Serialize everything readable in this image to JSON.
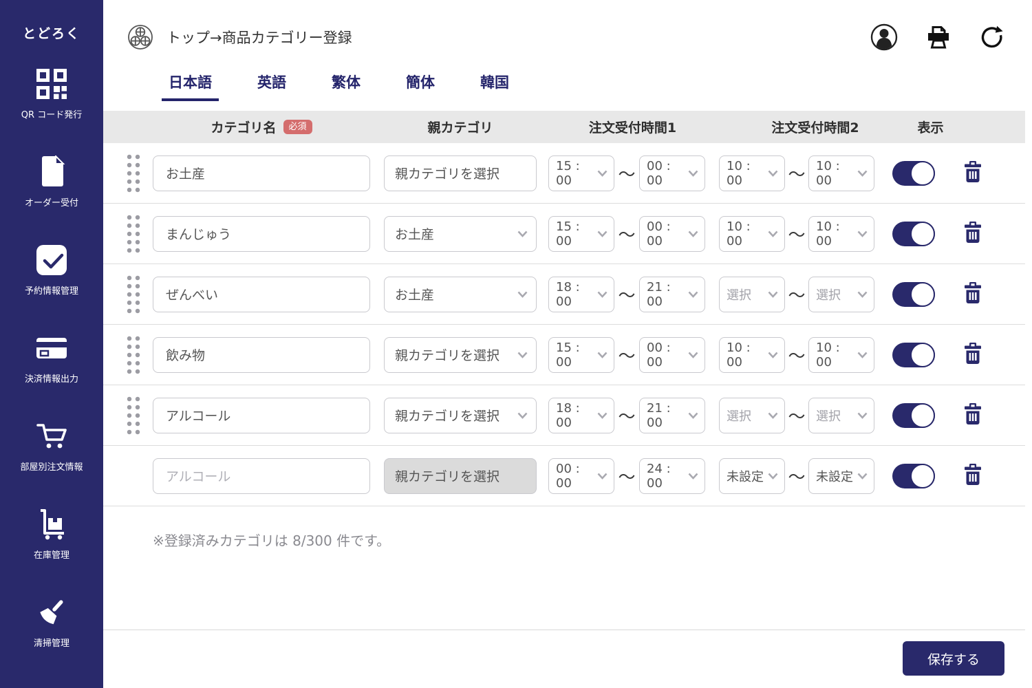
{
  "colors": {
    "navy": "#29296B",
    "badge_red": "#D46D6D",
    "table_header_bg": "#E8E8E8"
  },
  "sidebar": {
    "logo": "とどろく",
    "items": [
      {
        "icon": "qr-icon",
        "label": "QR コード発行"
      },
      {
        "icon": "document-icon",
        "label": "オーダー受付"
      },
      {
        "icon": "check-icon",
        "label": "予約情報管理"
      },
      {
        "icon": "card-icon",
        "label": "決済情報出力"
      },
      {
        "icon": "cart-icon",
        "label": "部屋別注文情報"
      },
      {
        "icon": "stock-icon",
        "label": "在庫管理"
      },
      {
        "icon": "broom-icon",
        "label": "清掃管理"
      }
    ]
  },
  "header": {
    "breadcrumb": "トップ→商品カテゴリー登録",
    "icons": [
      "user-avatar-icon",
      "printer-icon",
      "refresh-icon"
    ]
  },
  "tabs": [
    {
      "label": "日本語",
      "active": true
    },
    {
      "label": "英語",
      "active": false
    },
    {
      "label": "繁体",
      "active": false
    },
    {
      "label": "簡体",
      "active": false
    },
    {
      "label": "韓国",
      "active": false
    }
  ],
  "table": {
    "headers": {
      "category_name": "カテゴリ名",
      "required_badge": "必須",
      "parent": "親カテゴリ",
      "time1": "注文受付時間1",
      "time2": "注文受付時間2",
      "display": "表示"
    },
    "tilde": "〜",
    "rows": [
      {
        "handle": true,
        "name": {
          "value": "お土産",
          "placeholder": false
        },
        "parent": {
          "value": "親カテゴリを選択",
          "chevron": false,
          "filled": false
        },
        "time1": {
          "from": "15:00",
          "to": "00:00",
          "muted": false
        },
        "time2": {
          "from": "10:00",
          "to": "10:00",
          "muted": false
        },
        "visible": true
      },
      {
        "handle": true,
        "name": {
          "value": "まんじゅう",
          "placeholder": false
        },
        "parent": {
          "value": "お土産",
          "chevron": true,
          "filled": false
        },
        "time1": {
          "from": "15:00",
          "to": "00:00",
          "muted": false
        },
        "time2": {
          "from": "10:00",
          "to": "10:00",
          "muted": false
        },
        "visible": true
      },
      {
        "handle": true,
        "name": {
          "value": "ぜんべい",
          "placeholder": false
        },
        "parent": {
          "value": "お土産",
          "chevron": true,
          "filled": false
        },
        "time1": {
          "from": "18:00",
          "to": "21:00",
          "muted": false
        },
        "time2": {
          "from": "選択",
          "to": "選択",
          "muted": true
        },
        "visible": true
      },
      {
        "handle": true,
        "name": {
          "value": "飲み物",
          "placeholder": false
        },
        "parent": {
          "value": "親カテゴリを選択",
          "chevron": true,
          "filled": false
        },
        "time1": {
          "from": "15:00",
          "to": "00:00",
          "muted": false
        },
        "time2": {
          "from": "10:00",
          "to": "10:00",
          "muted": false
        },
        "visible": true
      },
      {
        "handle": true,
        "name": {
          "value": "アルコール",
          "placeholder": false
        },
        "parent": {
          "value": "親カテゴリを選択",
          "chevron": true,
          "filled": false
        },
        "time1": {
          "from": "18:00",
          "to": "21:00",
          "muted": false
        },
        "time2": {
          "from": "選択",
          "to": "選択",
          "muted": true
        },
        "visible": true
      },
      {
        "handle": false,
        "name": {
          "value": "アルコール",
          "placeholder": true
        },
        "parent": {
          "value": "親カテゴリを選択",
          "chevron": false,
          "filled": true
        },
        "time1": {
          "from": "00:00",
          "to": "24:00",
          "muted": false
        },
        "time2": {
          "from": "未設定",
          "to": "未設定",
          "muted": false
        },
        "visible": true
      }
    ]
  },
  "note": "※登録済みカテゴリは 8/300 件です。",
  "save_label": "保存する"
}
